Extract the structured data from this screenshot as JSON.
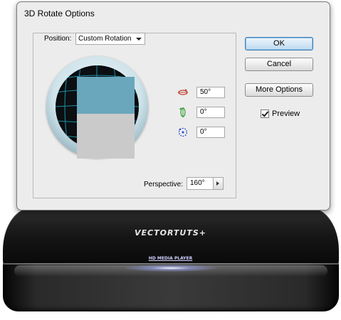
{
  "dialog": {
    "title": "3D Rotate Options",
    "position_label": "Position:",
    "position_value": "Custom Rotation",
    "rotation": {
      "x_value": "50°",
      "y_value": "0°",
      "z_value": "0°"
    },
    "perspective_label": "Perspective:",
    "perspective_value": "160°",
    "buttons": {
      "ok": "OK",
      "cancel": "Cancel",
      "more_options": "More Options"
    },
    "preview_label": "Preview",
    "preview_checked": true
  },
  "background": {
    "brand": "VECTORTUTS+",
    "device_label": "HD MEDIA PLAYER"
  },
  "colors": {
    "cube_top": "#6aa7bc",
    "cube_front": "#cacaca",
    "x_axis": "#c0392b",
    "y_axis": "#2e9b2e",
    "z_axis": "#2a49c9"
  },
  "icons": [
    "x-axis-rotate-icon",
    "y-axis-rotate-icon",
    "z-axis-rotate-icon",
    "chevron-down-icon",
    "chevron-right-icon",
    "checkmark-icon"
  ]
}
